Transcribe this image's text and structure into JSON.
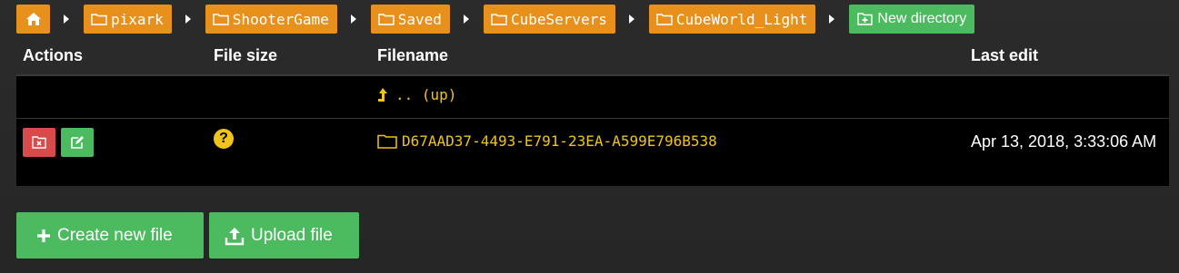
{
  "breadcrumb": {
    "items": [
      {
        "label": "pixark"
      },
      {
        "label": "ShooterGame"
      },
      {
        "label": "Saved"
      },
      {
        "label": "CubeServers"
      },
      {
        "label": "CubeWorld_Light"
      }
    ],
    "new_directory_label": "New directory"
  },
  "table": {
    "headers": {
      "actions": "Actions",
      "file_size": "File size",
      "filename": "Filename",
      "last_edit": "Last edit"
    },
    "up_row": {
      "label": ".. (up)"
    },
    "rows": [
      {
        "file_size_icon": "question-icon",
        "filename": "D67AAD37-4493-E791-23EA-A599E796B538",
        "last_edit": "Apr 13, 2018, 3:33:06 AM"
      }
    ]
  },
  "buttons": {
    "create_new_file": "Create new file",
    "upload_file": "Upload file"
  },
  "colors": {
    "background": "#2a2a2a",
    "breadcrumb": "#e8901c",
    "green": "#4cba5e",
    "red": "#d94a4a",
    "link": "#f0c419"
  },
  "icons": {
    "home": "home-icon",
    "folder": "folder-icon",
    "up": "level-up-icon",
    "delete": "delete-folder-icon",
    "edit": "edit-icon",
    "create": "plus-icon",
    "upload": "upload-icon"
  }
}
